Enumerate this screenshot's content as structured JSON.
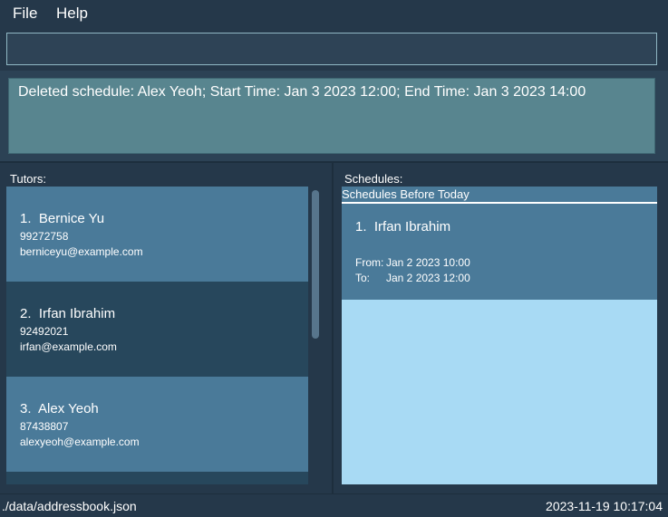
{
  "menu": {
    "file": "File",
    "help": "Help"
  },
  "command": {
    "value": "",
    "placeholder": ""
  },
  "result": {
    "message": "Deleted schedule: Alex Yeoh; Start Time: Jan 3 2023 12:00; End Time: Jan 3 2023 14:00"
  },
  "tutors": {
    "label": "Tutors:",
    "items": [
      {
        "index": "1.",
        "name": "Bernice Yu",
        "phone": "99272758",
        "email": "berniceyu@example.com"
      },
      {
        "index": "2.",
        "name": "Irfan Ibrahim",
        "phone": "92492021",
        "email": "irfan@example.com"
      },
      {
        "index": "3.",
        "name": "Alex Yeoh",
        "phone": "87438807",
        "email": "alexyeoh@example.com"
      }
    ]
  },
  "schedules": {
    "label": "Schedules:",
    "section_header": "Schedules Before Today",
    "items": [
      {
        "index": "1.",
        "name": "Irfan Ibrahim",
        "from_label": "From:",
        "from": "Jan 2 2023 10:00",
        "to_label": "To:",
        "to": "Jan 2 2023 12:00"
      }
    ]
  },
  "status": {
    "path": "./data/addressbook.json",
    "time": "2023-11-19 10:17:04"
  },
  "colors": {
    "background": "#25384a",
    "card_light": "#4a7a99",
    "card_dark": "#27475c",
    "result_box": "#58858f",
    "schedule_bg": "#a8daf4"
  }
}
